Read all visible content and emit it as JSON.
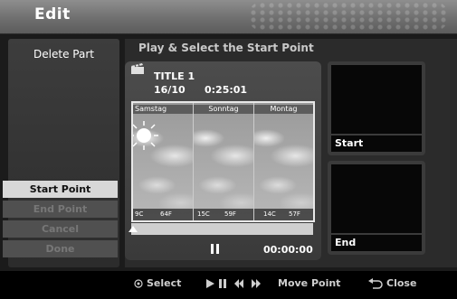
{
  "header": {
    "title": "Edit"
  },
  "sidebar": {
    "heading": "Delete Part",
    "menu": [
      {
        "label": "Start Point"
      },
      {
        "label": "End Point"
      },
      {
        "label": "Cancel"
      },
      {
        "label": "Done"
      }
    ]
  },
  "instruction": "Play & Select the Start Point",
  "player": {
    "title": "TITLE 1",
    "date": "16/10",
    "duration": "0:25:01",
    "timecode": "00:00:00",
    "progress": 0,
    "panels": [
      {
        "day": "Samstag",
        "low": "9C",
        "high": "64F"
      },
      {
        "day": "Sonntag",
        "low": "15C",
        "high": "59F"
      },
      {
        "day": "Montag",
        "low": "14C",
        "high": "57F"
      }
    ]
  },
  "thumbnails": {
    "start_label": "Start",
    "end_label": "End"
  },
  "footer": {
    "select": "Select",
    "move_point": "Move Point",
    "close": "Close"
  },
  "icons": {
    "select": "circle-select-icon",
    "play_controls": "play-pause-skip-icons",
    "close": "return-icon"
  }
}
